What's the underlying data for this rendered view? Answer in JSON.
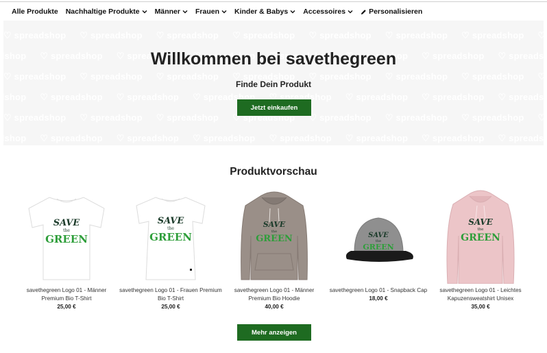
{
  "nav": {
    "items": [
      {
        "label": "Alle Produkte",
        "has_dropdown": false
      },
      {
        "label": "Nachhaltige Produkte",
        "has_dropdown": true
      },
      {
        "label": "Männer",
        "has_dropdown": true
      },
      {
        "label": "Frauen",
        "has_dropdown": true
      },
      {
        "label": "Kinder & Babys",
        "has_dropdown": true
      },
      {
        "label": "Accessoires",
        "has_dropdown": true
      },
      {
        "label": "Personalisieren",
        "has_dropdown": false,
        "icon": "pencil-icon"
      }
    ]
  },
  "hero": {
    "pattern_text": "spreadshop",
    "title": "Willkommen bei savethegreen",
    "subtitle": "Finde Dein Produkt",
    "button_label": "Jetzt einkaufen"
  },
  "preview": {
    "title": "Produktvorschau",
    "more_button_label": "Mehr anzeigen",
    "products": [
      {
        "name": "savethegreen Logo 01 - Männer Premium Bio T-Shirt",
        "price": "25,00 €",
        "kind": "tshirt",
        "color": "#ffffff"
      },
      {
        "name": "savethegreen Logo 01 - Frauen Premium Bio T-Shirt",
        "price": "25,00 €",
        "kind": "tshirt-women",
        "color": "#ffffff"
      },
      {
        "name": "savethegreen Logo 01 - Männer Premium Bio Hoodie",
        "price": "40,00 €",
        "kind": "hoodie",
        "color": "#9a8f88"
      },
      {
        "name": "savethegreen Logo 01 - Snapback Cap",
        "price": "18,00 €",
        "kind": "cap",
        "color": "#8f8f8f"
      },
      {
        "name": "savethegreen Logo 01 - Leichtes Kapuzensweatshirt Unisex",
        "price": "35,00 €",
        "kind": "light-hoodie",
        "color": "#ecc5c8"
      }
    ],
    "logo_text": {
      "top": "SAVE",
      "middle": "the",
      "bottom": "GREEN"
    }
  },
  "colors": {
    "accent": "#1e6b21",
    "hero_bg": "#f6f6f6",
    "logo_dark": "#1b3b2a",
    "logo_green": "#2e9e3a"
  }
}
